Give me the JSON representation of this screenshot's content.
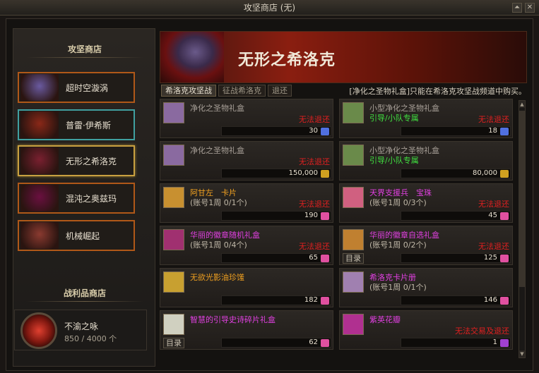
{
  "window": {
    "title": "攻坚商店 (无)"
  },
  "titlebar_icons": [
    "pin-icon",
    "close-icon"
  ],
  "left": {
    "shop_title": "攻坚商店",
    "nav": [
      {
        "label": "超时空漩涡",
        "thumb": "#6a5aa0"
      },
      {
        "label": "普雷·伊希斯",
        "thumb": "#8a2818"
      },
      {
        "label": "无形之希洛克",
        "thumb": "#7a2030"
      },
      {
        "label": "混沌之奥兹玛",
        "thumb": "#6a1040"
      },
      {
        "label": "机械崛起",
        "thumb": "#8a3a30"
      }
    ],
    "spoils_title": "战利品商店",
    "spoils": {
      "name": "不渝之咏",
      "count": "850 / 4000 个"
    }
  },
  "header": {
    "title": "无形之希洛克"
  },
  "tabs": [
    "希洛克攻坚战",
    "征战希洛克",
    "退还"
  ],
  "notice": "[净化之圣物礼盒]只能在希洛克攻坚战频道中购买。",
  "items": [
    {
      "name": "净化之圣物礼盒",
      "name_color": "gray",
      "sub": "",
      "warn": "无法退还",
      "price": "30",
      "currency": "blue",
      "icon": "#8a6aa0",
      "tag": ""
    },
    {
      "name": "小型净化之圣物礼盒",
      "name_color": "gray",
      "sub": "引导/小队专属",
      "sub_color": "green",
      "warn": "无法退还",
      "price": "18",
      "currency": "blue",
      "icon": "#6a8a4a",
      "tag": ""
    },
    {
      "name": "净化之圣物礼盒",
      "name_color": "gray",
      "sub": "",
      "warn": "无法退还",
      "price": "150,000",
      "currency": "gold",
      "icon": "#8a6aa0",
      "tag": ""
    },
    {
      "name": "小型净化之圣物礼盒",
      "name_color": "gray",
      "sub": "引导/小队专属",
      "sub_color": "green",
      "warn": "",
      "price": "80,000",
      "currency": "gold",
      "icon": "#6a8a4a",
      "tag": ""
    },
    {
      "name": "阿甘左　卡片",
      "name_color": "orange",
      "sub": "(账号1周 0/1个)",
      "sub_color": "sub",
      "warn": "无法退还",
      "price": "190",
      "currency": "pink",
      "icon": "#c89030",
      "tag": ""
    },
    {
      "name": "天界支援兵　宝珠",
      "name_color": "pink",
      "sub": "(账号1周 0/3个)",
      "sub_color": "sub",
      "warn": "无法退还",
      "price": "45",
      "currency": "pink",
      "icon": "#d06080",
      "tag": ""
    },
    {
      "name": "华丽的徽章随机礼盒",
      "name_color": "pink",
      "sub": "(账号1周 0/4个)",
      "sub_color": "sub",
      "warn": "无法退还",
      "price": "65",
      "currency": "pink",
      "icon": "#a03070",
      "tag": ""
    },
    {
      "name": "华丽的徽章自选礼盒",
      "name_color": "pink",
      "sub": "(账号1周 0/2个)",
      "sub_color": "sub",
      "warn": "无法退还",
      "price": "125",
      "currency": "pink",
      "icon": "#c08030",
      "tag": "目录"
    },
    {
      "name": "无欲光影油珍馐",
      "name_color": "orange",
      "sub": "",
      "warn": "",
      "price": "182",
      "currency": "pink",
      "icon": "#c8a030",
      "tag": ""
    },
    {
      "name": "希洛克卡片册",
      "name_color": "pink",
      "sub": "(账号1周 0/1个)",
      "sub_color": "sub",
      "warn": "",
      "price": "146",
      "currency": "pink",
      "icon": "#a080b0",
      "tag": ""
    },
    {
      "name": "智慧的引导史诗碎片礼盒",
      "name_color": "pink",
      "sub": "",
      "warn": "",
      "price": "62",
      "currency": "pink",
      "icon": "#d0d0c0",
      "tag": "目录"
    },
    {
      "name": "紫英花瓣",
      "name_color": "pink",
      "sub": "",
      "warn": "无法交易及退还",
      "price": "1",
      "currency": "purple",
      "icon": "#b03090",
      "tag": ""
    }
  ]
}
